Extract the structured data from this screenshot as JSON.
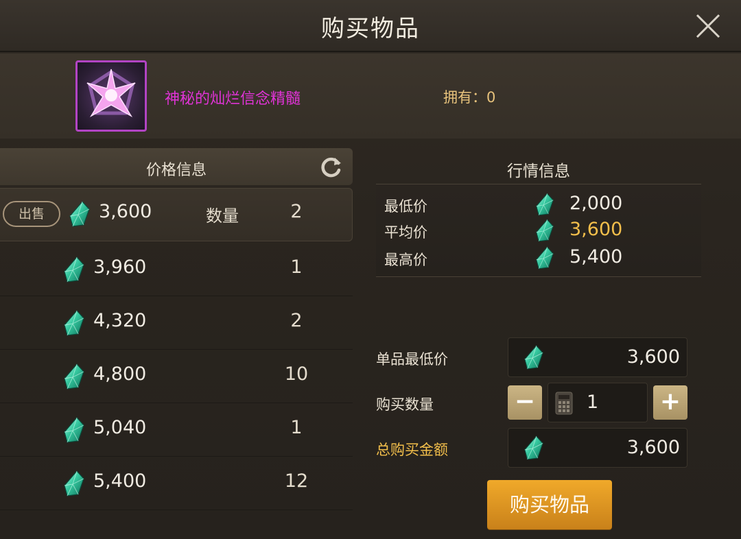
{
  "window": {
    "title": "购买物品"
  },
  "item": {
    "name": "神秘的灿烂信念精髓",
    "own_label": "拥有：",
    "own_count": "0"
  },
  "price_panel": {
    "header": "价格信息",
    "sell_tag": "出售",
    "qty_label": "数量",
    "rows": [
      {
        "price": "3,600",
        "qty": "2"
      },
      {
        "price": "3,960",
        "qty": "1"
      },
      {
        "price": "4,320",
        "qty": "2"
      },
      {
        "price": "4,800",
        "qty": "10"
      },
      {
        "price": "5,040",
        "qty": "1"
      },
      {
        "price": "5,400",
        "qty": "12"
      }
    ]
  },
  "market_panel": {
    "header": "行情信息",
    "rows": [
      {
        "label": "最低价",
        "value": "2,000"
      },
      {
        "label": "平均价",
        "value": "3,600"
      },
      {
        "label": "最高价",
        "value": "5,400"
      }
    ]
  },
  "purchase_form": {
    "unit_min_label": "单品最低价",
    "unit_min_value": "3,600",
    "qty_label": "购买数量",
    "qty_value": "1",
    "minus": "−",
    "plus": "+",
    "total_label": "总购买金额",
    "total_value": "3,600",
    "buy_button": "购买物品"
  },
  "colors": {
    "gem": "#2fbf9a",
    "accent_gold": "#f3bf4b",
    "item_purple": "#e033d6",
    "button_orange": "#e69a22"
  }
}
